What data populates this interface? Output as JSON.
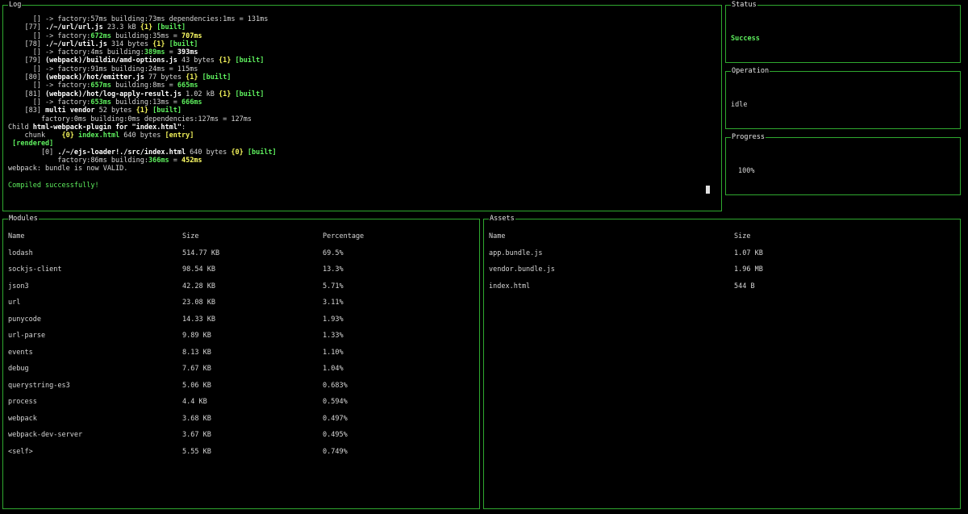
{
  "log": {
    "title": "Log",
    "lines": [
      [
        {
          "t": "      [] -> factory:57ms building:73ms dependencies:1ms = 131ms",
          "c": ""
        }
      ],
      [
        {
          "t": "    [77] ",
          "c": ""
        },
        {
          "t": "./~/url/url.js",
          "c": "b"
        },
        {
          "t": " 23.3 kB ",
          "c": ""
        },
        {
          "t": "{1}",
          "c": "y"
        },
        {
          "t": " [built]",
          "c": "gb"
        }
      ],
      [
        {
          "t": "      [] -> factory:",
          "c": ""
        },
        {
          "t": "672ms",
          "c": "gb"
        },
        {
          "t": " building:35ms = ",
          "c": ""
        },
        {
          "t": "707ms",
          "c": "yb"
        }
      ],
      [
        {
          "t": "    [78] ",
          "c": ""
        },
        {
          "t": "./~/url/util.js",
          "c": "b"
        },
        {
          "t": " 314 bytes ",
          "c": ""
        },
        {
          "t": "{1}",
          "c": "y"
        },
        {
          "t": " [built]",
          "c": "gb"
        }
      ],
      [
        {
          "t": "      [] -> factory:4ms building:",
          "c": ""
        },
        {
          "t": "389ms",
          "c": "gb"
        },
        {
          "t": " = ",
          "c": ""
        },
        {
          "t": "393ms",
          "c": "b"
        }
      ],
      [
        {
          "t": "    [79] ",
          "c": ""
        },
        {
          "t": "(webpack)/buildin/amd-options.js",
          "c": "b"
        },
        {
          "t": " 43 bytes ",
          "c": ""
        },
        {
          "t": "{1}",
          "c": "y"
        },
        {
          "t": " [built]",
          "c": "gb"
        }
      ],
      [
        {
          "t": "      [] -> factory:91ms building:24ms = 115ms",
          "c": ""
        }
      ],
      [
        {
          "t": "    [80] ",
          "c": ""
        },
        {
          "t": "(webpack)/hot/emitter.js",
          "c": "b"
        },
        {
          "t": " 77 bytes ",
          "c": ""
        },
        {
          "t": "{1}",
          "c": "y"
        },
        {
          "t": " [built]",
          "c": "gb"
        }
      ],
      [
        {
          "t": "      [] -> factory:",
          "c": ""
        },
        {
          "t": "657ms",
          "c": "gb"
        },
        {
          "t": " building:8ms = ",
          "c": ""
        },
        {
          "t": "665ms",
          "c": "gb"
        }
      ],
      [
        {
          "t": "    [81] ",
          "c": ""
        },
        {
          "t": "(webpack)/hot/log-apply-result.js",
          "c": "b"
        },
        {
          "t": " 1.02 kB ",
          "c": ""
        },
        {
          "t": "{1}",
          "c": "y"
        },
        {
          "t": " [built]",
          "c": "gb"
        }
      ],
      [
        {
          "t": "      [] -> factory:",
          "c": ""
        },
        {
          "t": "653ms",
          "c": "gb"
        },
        {
          "t": " building:13ms = ",
          "c": ""
        },
        {
          "t": "666ms",
          "c": "gb"
        }
      ],
      [
        {
          "t": "    [83] ",
          "c": ""
        },
        {
          "t": "multi vendor",
          "c": "b"
        },
        {
          "t": " 52 bytes ",
          "c": ""
        },
        {
          "t": "{1}",
          "c": "y"
        },
        {
          "t": " [built]",
          "c": "gb"
        }
      ],
      [
        {
          "t": "        factory:0ms building:0ms dependencies:127ms = 127ms",
          "c": ""
        }
      ],
      [
        {
          "t": "Child ",
          "c": ""
        },
        {
          "t": "html-webpack-plugin for \"index.html\"",
          "c": "b"
        },
        {
          "t": ":",
          "c": ""
        }
      ],
      [
        {
          "t": "    chunk    ",
          "c": ""
        },
        {
          "t": "{0}",
          "c": "y"
        },
        {
          "t": " index.html",
          "c": "gb"
        },
        {
          "t": " 640 bytes ",
          "c": ""
        },
        {
          "t": "[entry]",
          "c": "y"
        }
      ],
      [
        {
          "t": " [rendered]",
          "c": "gb"
        }
      ],
      [
        {
          "t": "        [0] ",
          "c": ""
        },
        {
          "t": "./~/ejs-loader!./src/index.html",
          "c": "b"
        },
        {
          "t": " 640 bytes ",
          "c": ""
        },
        {
          "t": "{0}",
          "c": "y"
        },
        {
          "t": " [built]",
          "c": "gb"
        }
      ],
      [
        {
          "t": "            factory:86ms building:",
          "c": ""
        },
        {
          "t": "366ms",
          "c": "gb"
        },
        {
          "t": " = ",
          "c": ""
        },
        {
          "t": "452ms",
          "c": "yb"
        }
      ],
      [
        {
          "t": "webpack: bundle is now VALID.",
          "c": ""
        }
      ],
      [
        {
          "t": "",
          "c": ""
        }
      ],
      [
        {
          "t": "Compiled successfully!",
          "c": "g"
        }
      ]
    ]
  },
  "status": {
    "title": "Status",
    "value": "Success"
  },
  "operation": {
    "title": "Operation",
    "value": "idle"
  },
  "progress": {
    "title": "Progress",
    "value": "100%",
    "percent": 100
  },
  "modules": {
    "title": "Modules",
    "headers": [
      "Name",
      "Size",
      "Percentage"
    ],
    "rows": [
      [
        "lodash",
        "514.77 KB",
        "69.5%"
      ],
      [
        "sockjs-client",
        "98.54 KB",
        "13.3%"
      ],
      [
        "json3",
        "42.28 KB",
        "5.71%"
      ],
      [
        "url",
        "23.08 KB",
        "3.11%"
      ],
      [
        "punycode",
        "14.33 KB",
        "1.93%"
      ],
      [
        "url-parse",
        "9.89 KB",
        "1.33%"
      ],
      [
        "events",
        "8.13 KB",
        "1.10%"
      ],
      [
        "debug",
        "7.67 KB",
        "1.04%"
      ],
      [
        "querystring-es3",
        "5.06 KB",
        "0.683%"
      ],
      [
        "process",
        "4.4 KB",
        "0.594%"
      ],
      [
        "webpack",
        "3.68 KB",
        "0.497%"
      ],
      [
        "webpack-dev-server",
        "3.67 KB",
        "0.495%"
      ],
      [
        "<self>",
        "5.55 KB",
        "0.749%"
      ]
    ]
  },
  "assets": {
    "title": "Assets",
    "headers": [
      "Name",
      "Size"
    ],
    "rows": [
      [
        "app.bundle.js",
        "1.07 KB"
      ],
      [
        "vendor.bundle.js",
        "1.96 MB"
      ],
      [
        "index.html",
        "544 B"
      ]
    ]
  },
  "colors": {
    "border": "#2fa82f",
    "success": "#5ef05e",
    "highlight": "#f2f25a",
    "background": "#000000"
  }
}
